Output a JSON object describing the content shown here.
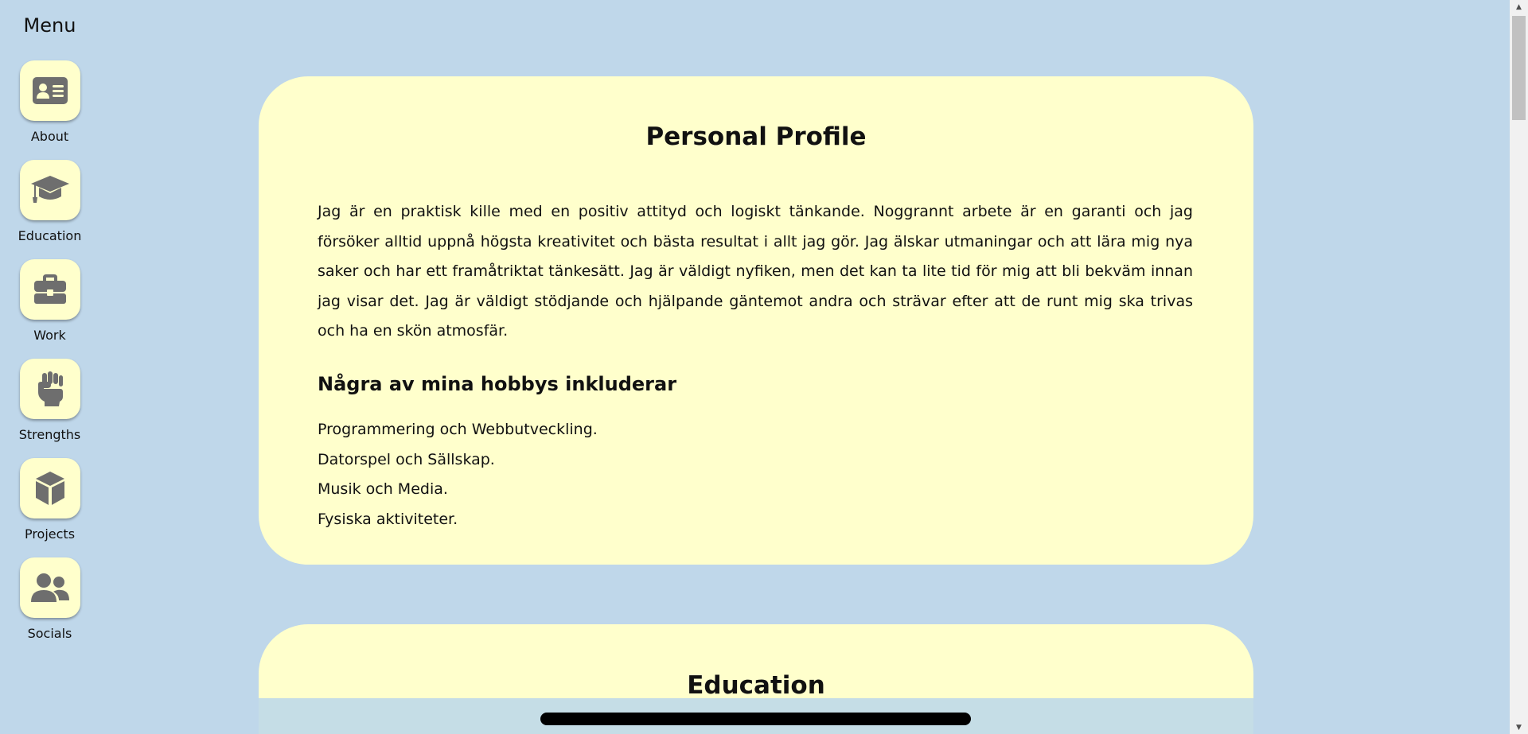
{
  "sidebar": {
    "title": "Menu",
    "items": [
      {
        "label": "About",
        "icon": "id-card-icon"
      },
      {
        "label": "Education",
        "icon": "graduation-cap-icon"
      },
      {
        "label": "Work",
        "icon": "briefcase-icon"
      },
      {
        "label": "Strengths",
        "icon": "fist-icon"
      },
      {
        "label": "Projects",
        "icon": "cube-icon"
      },
      {
        "label": "Socials",
        "icon": "users-icon"
      }
    ]
  },
  "profile": {
    "title": "Personal Profile",
    "bio": "Jag är en praktisk kille med en positiv attityd och logiskt tänkande. Noggrannt arbete är en garanti och jag försöker alltid uppnå högsta kreativitet och bästa resultat i allt jag gör. Jag älskar utmaningar och att lära mig nya saker och har ett framåtriktat tänkesätt. Jag är väldigt nyfiken, men det kan ta lite tid för mig att bli bekväm innan jag visar det. Jag är väldigt stödjande och hjälpande gäntemot andra och strävar efter att de runt mig ska trivas och ha en skön atmosfär.",
    "hobbies_heading": "Några av mina hobbys inkluderar",
    "hobbies": [
      "Programmering och Webbutveckling.",
      "Datorspel och Sällskap.",
      "Musik och Media.",
      "Fysiska aktiviteter."
    ]
  },
  "education": {
    "title": "Education"
  },
  "colors": {
    "background": "#bfd7ea",
    "card": "#ffffcc",
    "icon": "#6e6e6e"
  }
}
